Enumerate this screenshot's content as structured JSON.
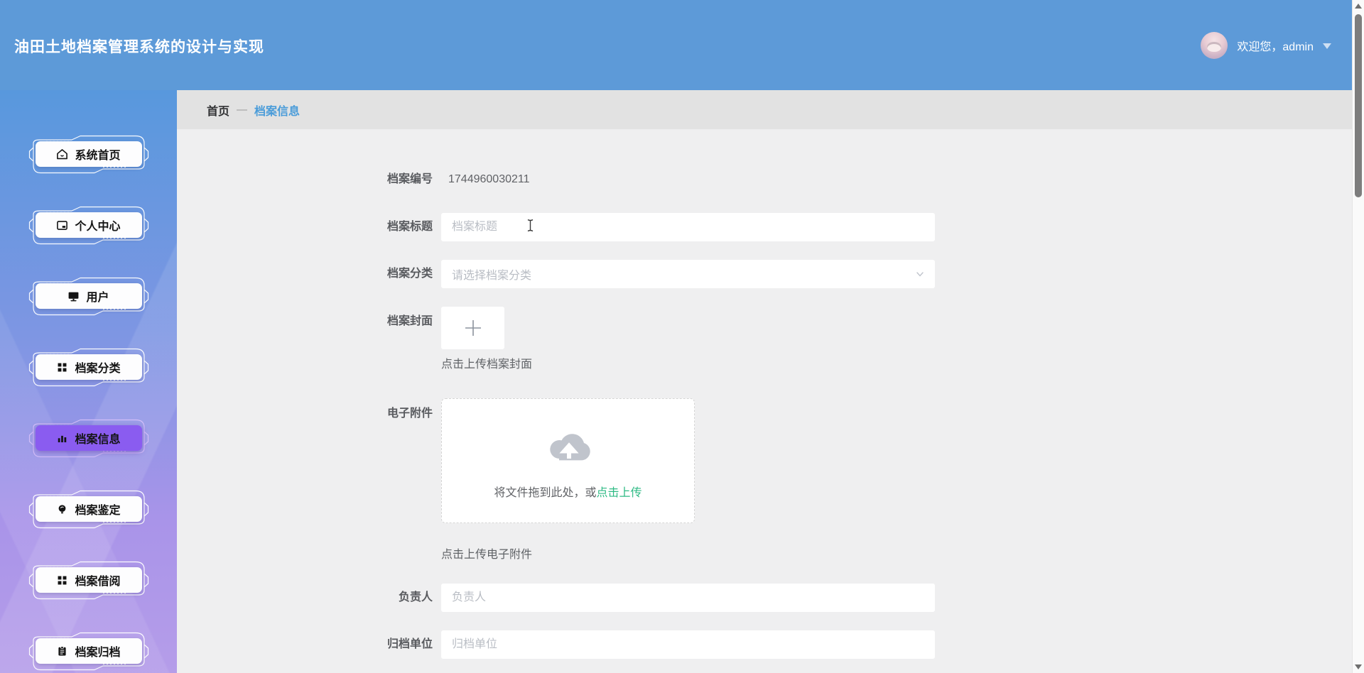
{
  "header": {
    "title": "油田土地档案管理系统的设计与实现",
    "welcome": "欢迎您，admin"
  },
  "sidebar": {
    "items": [
      {
        "label": "系统首页",
        "icon": "home-icon",
        "active": false
      },
      {
        "label": "个人中心",
        "icon": "id-card-icon",
        "active": false
      },
      {
        "label": "用户",
        "icon": "monitor-icon",
        "active": false
      },
      {
        "label": "档案分类",
        "icon": "grid-icon",
        "active": false
      },
      {
        "label": "档案信息",
        "icon": "bar-chart-icon",
        "active": true
      },
      {
        "label": "档案鉴定",
        "icon": "bulb-icon",
        "active": false
      },
      {
        "label": "档案借阅",
        "icon": "grid-icon",
        "active": false
      },
      {
        "label": "档案归档",
        "icon": "clipboard-icon",
        "active": false
      }
    ]
  },
  "breadcrumb": {
    "home": "首页",
    "separator": "—",
    "current": "档案信息"
  },
  "form": {
    "archive_no": {
      "label": "档案编号",
      "value": "1744960030211"
    },
    "title": {
      "label": "档案标题",
      "placeholder": "档案标题"
    },
    "category": {
      "label": "档案分类",
      "placeholder": "请选择档案分类"
    },
    "cover": {
      "label": "档案封面",
      "tip": "点击上传档案封面"
    },
    "attachment": {
      "label": "电子附件",
      "drop_text": "将文件拖到此处，或",
      "drop_link": "点击上传",
      "tip": "点击上传电子附件"
    },
    "manager": {
      "label": "负责人",
      "placeholder": "负责人"
    },
    "unit": {
      "label": "归档单位",
      "placeholder": "归档单位"
    }
  },
  "colors": {
    "header_blue": "#5d9ad8",
    "sidebar_gradient_top": "#5898dd",
    "sidebar_gradient_bottom": "#b59de9",
    "active_item_purple": "#8a5cf0",
    "breadcrumb_link_blue": "#4a9cd9",
    "upload_link_green": "#2eba84"
  }
}
